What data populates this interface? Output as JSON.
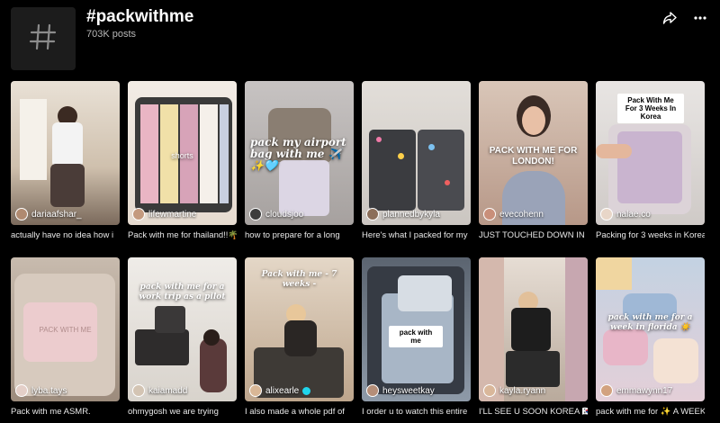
{
  "hashtag": {
    "title": "#packwithme",
    "post_count": "703K posts"
  },
  "header_icons": [
    "hash-icon",
    "share-icon",
    "more-icon"
  ],
  "videos": [
    {
      "author": "dariaafshar_",
      "caption": "actually have no idea how i",
      "overlay": "",
      "bg": "#d8cbb8",
      "accent": "#a48a70"
    },
    {
      "author": "lifewmartine",
      "caption": "Pack with me for thailand!!🌴",
      "overlay": "shorts",
      "bg": "#e8ddd3",
      "accent": "#e9a6b9"
    },
    {
      "author": "cloudsjoo",
      "caption": "how to prepare for a long",
      "overlay": "pack my airport bag with me ✈️✨🩵",
      "bg": "#cfc8c2",
      "accent": "#6e6c74"
    },
    {
      "author": "plannedbykyla",
      "caption": "Here's what I packed for my",
      "overlay": "",
      "bg": "#d9d4cf",
      "accent": "#3c3c40"
    },
    {
      "author": "evecohenn",
      "caption": "JUST TOUCHED DOWN IN",
      "overlay": "PACK WITH ME FOR LONDON!",
      "bg": "#d7c0b0",
      "accent": "#8a6a5c"
    },
    {
      "author": "nalae.co",
      "caption": "Packing for 3 weeks in Korea",
      "overlay": "Pack With Me For 3 Weeks In Korea",
      "bg": "#dfdad7",
      "accent": "#c9b8c8"
    },
    {
      "author": "lyba.tays",
      "caption": "Pack with me ASMR.",
      "overlay": "PACK WITH ME",
      "bg": "#b5a698",
      "accent": "#e7c8ca"
    },
    {
      "author": "kaiamadd",
      "caption": "ohmygosh we are trying",
      "overlay": "pack with me for a work trip as a pilot",
      "bg": "#e6e2dc",
      "accent": "#2c2a2a"
    },
    {
      "author": "alixearle",
      "caption": "I also made a whole pdf of",
      "overlay": "Pack with me - 7 weeks -",
      "bg": "#d8c6b0",
      "accent": "#3b3734"
    },
    {
      "author": "heysweetkay",
      "caption": "I order u to watch this entire",
      "overlay": "pack with me",
      "bg": "#8d9bab",
      "accent": "#c2cbd4"
    },
    {
      "author": "kayla.ryann",
      "caption": "I'LL SEE U SOON KOREA 🇰🇷✈️",
      "overlay": "",
      "bg": "#cbbfb3",
      "accent": "#1d1d1d"
    },
    {
      "author": "emmawynn17",
      "caption": "pack with me for ✨ A WEEK",
      "overlay": "pack with me for a week in florida ☀️",
      "bg": "#bfd0e2",
      "accent": "#e8b3c7"
    }
  ]
}
